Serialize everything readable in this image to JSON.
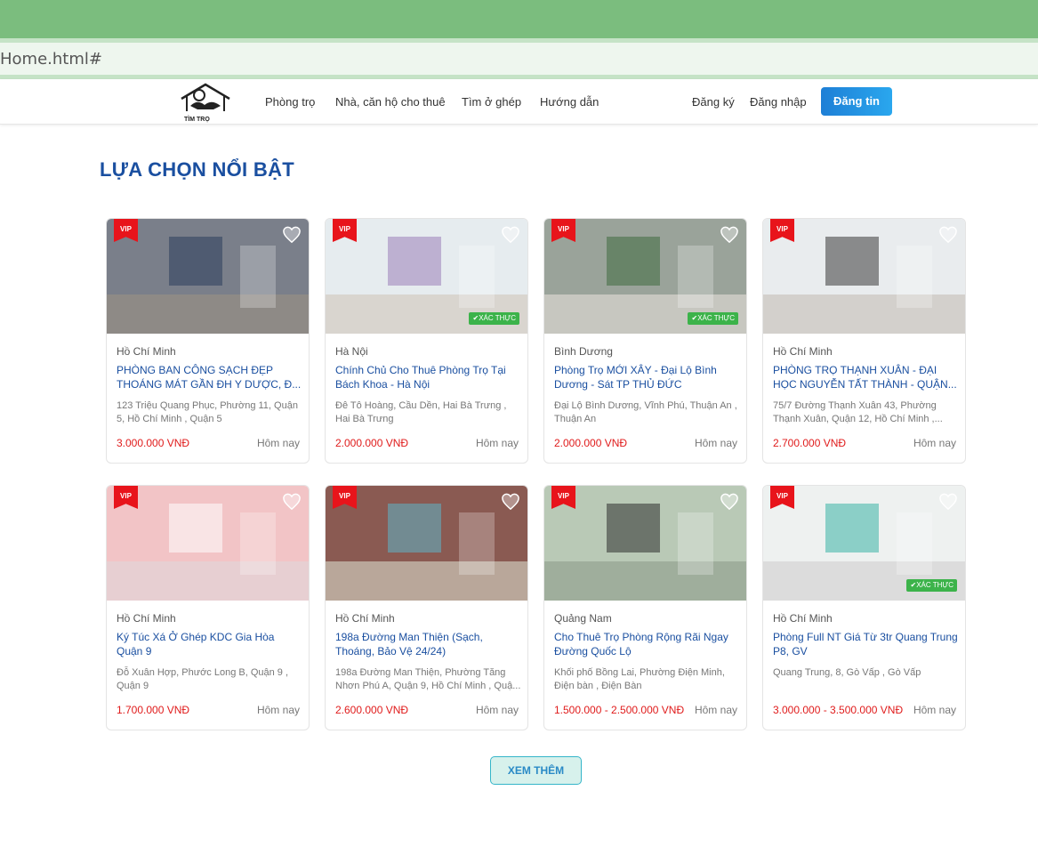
{
  "browser": {
    "address": "Home.html#"
  },
  "nav": {
    "links": [
      "Phòng trọ",
      "Nhà, căn hộ cho thuê",
      "Tìm ở ghép",
      "Hướng dẫn"
    ],
    "register": "Đăng ký",
    "login": "Đăng nhập",
    "post_button": "Đăng tin",
    "logo_text": "TÌM TRỌ"
  },
  "section_title": "LỰA CHỌN NỔI BẬT",
  "badges": {
    "vip": "VIP",
    "verified": "✔XÁC THỰC"
  },
  "listings": [
    {
      "city": "Hồ Chí Minh",
      "title": "PHÒNG BAN CÔNG SẠCH ĐẸP THOÁNG MÁT GẦN ĐH Y DƯỢC, Đ...",
      "address": "123 Triệu Quang Phục, Phường 11, Quận 5, Hồ Chí Minh , Quận 5",
      "price": "3.000.000 VNĐ",
      "time": "Hôm nay",
      "verified": false
    },
    {
      "city": "Hà Nội",
      "title": "Chính Chủ Cho Thuê Phòng Trọ Tại Bách Khoa - Hà Nội",
      "address": "Đê Tô Hoàng, Cầu Dền, Hai Bà Trưng , Hai Bà Trưng",
      "price": "2.000.000 VNĐ",
      "time": "Hôm nay",
      "verified": true
    },
    {
      "city": "Bình Dương",
      "title": "Phòng Trọ MỚI XÂY - Đại Lộ Bình Dương - Sát TP THỦ ĐỨC",
      "address": "Đại Lộ Bình Dương, Vĩnh Phú, Thuận An , Thuận An",
      "price": "2.000.000 VNĐ",
      "time": "Hôm nay",
      "verified": true
    },
    {
      "city": "Hồ Chí Minh",
      "title": "PHÒNG TRỌ THẠNH XUÂN - ĐẠI HỌC NGUYỄN TẤT THÀNH - QUẬN...",
      "address": "75/7 Đường Thạnh Xuân 43, Phường Thạnh Xuân, Quận 12, Hồ Chí Minh ,...",
      "price": "2.700.000 VNĐ",
      "time": "Hôm nay",
      "verified": false
    },
    {
      "city": "Hồ Chí Minh",
      "title": "Ký Túc Xá Ở Ghép KDC Gia Hòa Quận 9",
      "address": "Đỗ Xuân Hợp, Phước Long B, Quận 9 , Quận 9",
      "price": "1.700.000 VNĐ",
      "time": "Hôm nay",
      "verified": false
    },
    {
      "city": "Hồ Chí Minh",
      "title": "198a Đường Man Thiện (Sạch, Thoáng, Bảo Vệ 24/24)",
      "address": "198a Đường Man Thiện, Phường Tăng Nhơn Phú A, Quận 9, Hồ Chí Minh , Quậ...",
      "price": "2.600.000 VNĐ",
      "time": "Hôm nay",
      "verified": false
    },
    {
      "city": "Quảng Nam",
      "title": "Cho Thuê Trọ Phòng Rộng Rãi Ngay Đường Quốc Lộ",
      "address": "Khối phố Bồng Lai, Phường Điện Minh, Điện bàn , Điện Bàn",
      "price": "1.500.000 - 2.500.000 VNĐ",
      "time": "Hôm nay",
      "verified": false
    },
    {
      "city": "Hồ Chí Minh",
      "title": "Phòng Full NT Giá Từ 3tr Quang Trung P8, GV",
      "address": "Quang Trung, 8, Gò Vấp , Gò Vấp",
      "price": "3.000.000 - 3.500.000 VNĐ",
      "time": "Hôm nay",
      "verified": true
    }
  ],
  "more_button": "XEM THÊM"
}
